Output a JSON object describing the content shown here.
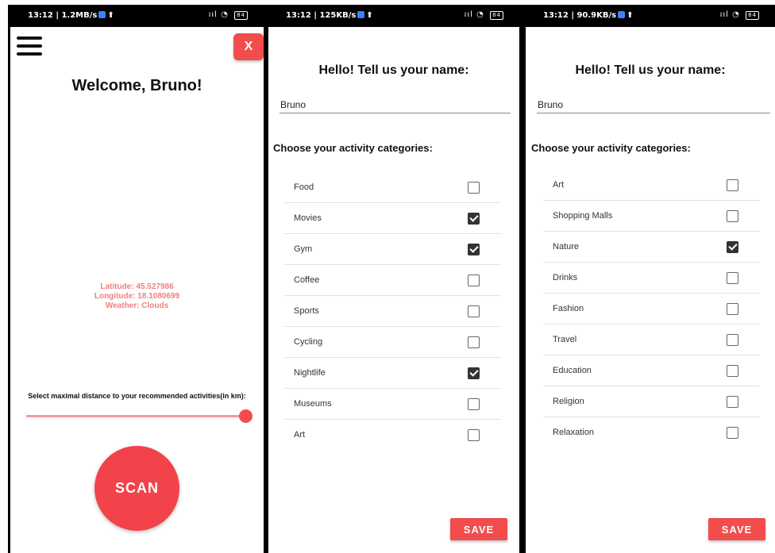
{
  "colors": {
    "accent": "#f24c4c",
    "info_text": "#f08080",
    "frame": "#000000"
  },
  "screen1": {
    "status": {
      "time": "13:12 | 1.2MB/s",
      "battery": "84"
    },
    "menu_icon": "hamburger-icon",
    "close_label": "X",
    "welcome": "Welcome, Bruno!",
    "latitude": "Latitude: 45.527986",
    "longitude": "Longitude: 18.1080699",
    "weather": "Weather: Clouds",
    "distance_label": "Select maximal distance to your recommended activities(in km):",
    "distance_slider_fraction": 0.98,
    "scan_label": "SCAN"
  },
  "screen2": {
    "status": {
      "time": "13:12 | 125KB/s",
      "battery": "84"
    },
    "title": "Hello! Tell us your name:",
    "name_value": "Bruno",
    "categories_heading": "Choose your activity categories:",
    "categories": [
      {
        "label": "Food",
        "checked": false
      },
      {
        "label": "Movies",
        "checked": true
      },
      {
        "label": "Gym",
        "checked": true
      },
      {
        "label": "Coffee",
        "checked": false
      },
      {
        "label": "Sports",
        "checked": false
      },
      {
        "label": "Cycling",
        "checked": false
      },
      {
        "label": "Nightlife",
        "checked": true
      },
      {
        "label": "Museums",
        "checked": false
      },
      {
        "label": "Art",
        "checked": false
      }
    ],
    "save_label": "SAVE"
  },
  "screen3": {
    "status": {
      "time": "13:12 | 90.9KB/s",
      "battery": "84"
    },
    "title": "Hello! Tell us your name:",
    "name_value": "Bruno",
    "categories_heading": "Choose your activity categories:",
    "categories": [
      {
        "label": "Art",
        "checked": false
      },
      {
        "label": "Shopping Malls",
        "checked": false
      },
      {
        "label": "Nature",
        "checked": true
      },
      {
        "label": "Drinks",
        "checked": false
      },
      {
        "label": "Fashion",
        "checked": false
      },
      {
        "label": "Travel",
        "checked": false
      },
      {
        "label": "Education",
        "checked": false
      },
      {
        "label": "Religion",
        "checked": false
      },
      {
        "label": "Relaxation",
        "checked": false
      }
    ],
    "save_label": "SAVE"
  }
}
